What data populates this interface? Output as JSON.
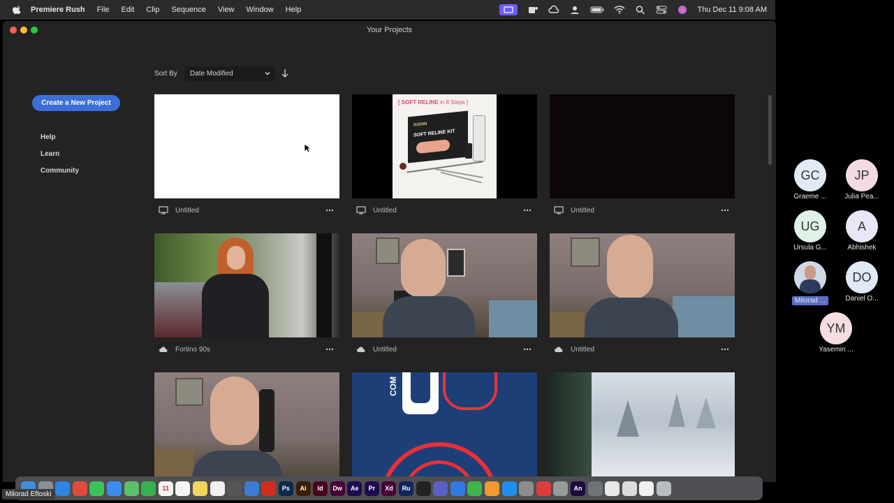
{
  "menubar": {
    "app_name": "Premiere Rush",
    "menus": [
      "File",
      "Edit",
      "Clip",
      "Sequence",
      "View",
      "Window",
      "Help"
    ],
    "datetime": "Thu Dec 11  9:08 AM"
  },
  "window": {
    "title": "Your Projects"
  },
  "sidebar": {
    "create_button": "Create a New Project",
    "links": [
      "Help",
      "Learn",
      "Community"
    ]
  },
  "sort": {
    "label": "Sort By",
    "value": "Date Modified"
  },
  "projects": [
    {
      "name": "Untitled",
      "storage": "monitor-icon"
    },
    {
      "name": "Untitled",
      "storage": "monitor-icon",
      "thumb_text_1": "[ SOFT RELINE",
      "thumb_text_2": " in 8 Steps ]",
      "thumb_box_brand": "RODIN",
      "thumb_box_label": "SOFT RELINE KIT"
    },
    {
      "name": "Untitled",
      "storage": "monitor-icon"
    },
    {
      "name": "Fortino 90s",
      "storage": "cloud-icon"
    },
    {
      "name": "Untitled",
      "storage": "cloud-icon"
    },
    {
      "name": "Untitled",
      "storage": "cloud-icon"
    },
    {
      "name": "",
      "storage": ""
    },
    {
      "name": "",
      "storage": "",
      "thumb_text": "COM"
    },
    {
      "name": "",
      "storage": ""
    }
  ],
  "participants": [
    {
      "initials": "GC",
      "name": "Graeme ...",
      "color": "#e2eaf6"
    },
    {
      "initials": "JP",
      "name": "Julia Pea...",
      "color": "#f4dbe2"
    },
    {
      "initials": "UG",
      "name": "Ursula G...",
      "color": "#dff2e6"
    },
    {
      "initials": "A",
      "name": "Abhishek",
      "color": "#e9e6f7"
    },
    {
      "initials": "",
      "name": "Milorad ...",
      "color": "#cfd8e6"
    },
    {
      "initials": "DO",
      "name": "Daniel O...",
      "color": "#e0e9f5"
    },
    {
      "initials": "YM",
      "name": "Yasemin ...",
      "color": "#f6dde0"
    }
  ],
  "video_label": "Milorad Eftoski",
  "dock": [
    {
      "icon": "finder-icon",
      "label": "",
      "color": "#3d8de0"
    },
    {
      "icon": "launchpad-icon",
      "label": "",
      "color": "#8a8f98"
    },
    {
      "icon": "safari-icon",
      "label": "",
      "color": "#2d83e6"
    },
    {
      "icon": "chrome-icon",
      "label": "",
      "color": "#e24a3b"
    },
    {
      "icon": "messages-icon",
      "label": "",
      "color": "#3ac45a"
    },
    {
      "icon": "mail-icon",
      "label": "",
      "color": "#3a8df0"
    },
    {
      "icon": "maps-icon",
      "label": "",
      "color": "#5bbf6b"
    },
    {
      "icon": "facetime-icon",
      "label": "",
      "color": "#38b24f"
    },
    {
      "icon": "calendar-icon",
      "label": "11",
      "color": "#f2f2f2"
    },
    {
      "icon": "reminders-icon",
      "label": "",
      "color": "#f4f4f4"
    },
    {
      "icon": "notes-icon",
      "label": "",
      "color": "#f3d55c"
    },
    {
      "icon": "freeform-icon",
      "label": "",
      "color": "#f0f0f0"
    },
    {
      "icon": "calculator-icon",
      "label": "",
      "color": "#565656"
    },
    {
      "icon": "preview-icon",
      "label": "",
      "color": "#3a7bd5"
    },
    {
      "icon": "acrobat-icon",
      "label": "",
      "color": "#d52b1e"
    },
    {
      "icon": "photoshop-icon",
      "label": "Ps",
      "color": "#0b2a4a"
    },
    {
      "icon": "illustrator-icon",
      "label": "Ai",
      "color": "#3b1e04"
    },
    {
      "icon": "indesign-icon",
      "label": "Id",
      "color": "#49021f"
    },
    {
      "icon": "dreamweaver-icon",
      "label": "Dw",
      "color": "#470137"
    },
    {
      "icon": "after-effects-icon",
      "label": "Ae",
      "color": "#1e0b4f"
    },
    {
      "icon": "premiere-pro-icon",
      "label": "Pr",
      "color": "#1e0b4f"
    },
    {
      "icon": "xd-icon",
      "label": "Xd",
      "color": "#470137"
    },
    {
      "icon": "rush-icon",
      "label": "Ru",
      "color": "#12245c"
    },
    {
      "icon": "figma-icon",
      "label": "",
      "color": "#222222"
    },
    {
      "icon": "teams-icon",
      "label": "",
      "color": "#5b5fc7"
    },
    {
      "icon": "keynote-icon",
      "label": "",
      "color": "#2f7be0"
    },
    {
      "icon": "numbers-icon",
      "label": "",
      "color": "#3bb54a"
    },
    {
      "icon": "pages-icon",
      "label": "",
      "color": "#f29a2e"
    },
    {
      "icon": "app-store-icon",
      "label": "",
      "color": "#1f8ef1"
    },
    {
      "icon": "system-settings-icon",
      "label": "",
      "color": "#8d8d8d"
    },
    {
      "icon": "creative-cloud-icon",
      "label": "",
      "color": "#e23b3b"
    },
    {
      "icon": "screenshot-icon",
      "label": "",
      "color": "#9a9a9a"
    },
    {
      "icon": "animate-icon",
      "label": "An",
      "color": "#1c0a3f"
    },
    {
      "icon": "downloads-icon",
      "label": "",
      "color": "#6f7277"
    },
    {
      "icon": "documents-icon",
      "label": "",
      "color": "#e8e8e8"
    },
    {
      "icon": "folder-icon",
      "label": "",
      "color": "#dcdcdc"
    },
    {
      "icon": "folder2-icon",
      "label": "",
      "color": "#f0f0f0"
    },
    {
      "icon": "trash-icon",
      "label": "",
      "color": "#b9bcc0"
    }
  ]
}
